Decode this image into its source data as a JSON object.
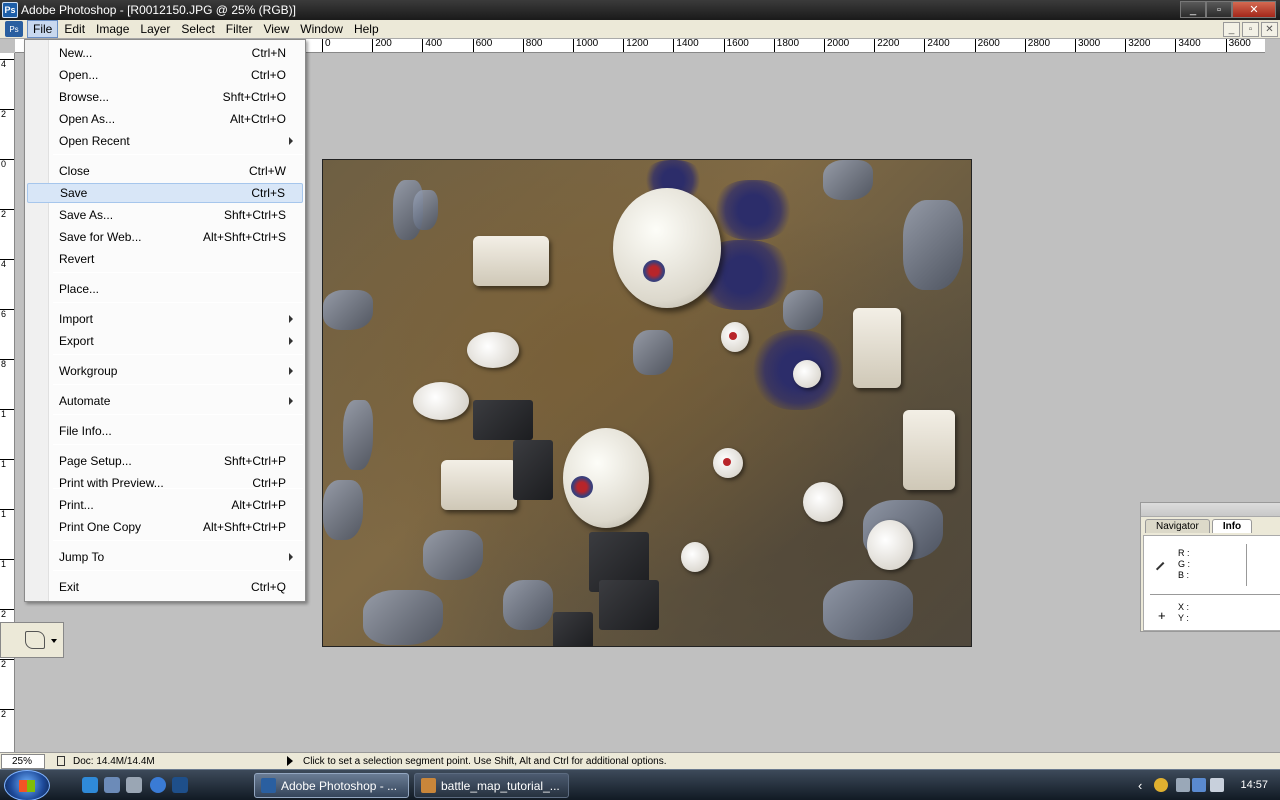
{
  "window": {
    "app_icon": "Ps",
    "title": "Adobe Photoshop - [R0012150.JPG @ 25% (RGB)]",
    "minimize": "_",
    "maximize": "▫",
    "close": "✕"
  },
  "menubar": {
    "items": [
      "File",
      "Edit",
      "Image",
      "Layer",
      "Select",
      "Filter",
      "View",
      "Window",
      "Help"
    ],
    "active": "File",
    "doc_controls": [
      "_",
      "▫",
      "✕"
    ]
  },
  "ruler_top": [
    "0",
    "200",
    "400",
    "600",
    "800",
    "1000",
    "1200",
    "1400",
    "1600",
    "1800",
    "2000",
    "2200",
    "2400",
    "2600",
    "2800",
    "3000",
    "3200",
    "3400",
    "3600"
  ],
  "ruler_left": [
    "4",
    "2",
    "0",
    "2",
    "4",
    "6",
    "8",
    "1",
    "1",
    "1",
    "1",
    "2",
    "2",
    "2",
    "2"
  ],
  "file_menu": {
    "items": [
      {
        "label": "New...",
        "shortcut": "Ctrl+N"
      },
      {
        "label": "Open...",
        "shortcut": "Ctrl+O"
      },
      {
        "label": "Browse...",
        "shortcut": "Shft+Ctrl+O"
      },
      {
        "label": "Open As...",
        "shortcut": "Alt+Ctrl+O"
      },
      {
        "label": "Open Recent",
        "shortcut": "",
        "submenu": true
      },
      {
        "label": "Close",
        "shortcut": "Ctrl+W"
      },
      {
        "label": "Save",
        "shortcut": "Ctrl+S",
        "highlighted": true
      },
      {
        "label": "Save As...",
        "shortcut": "Shft+Ctrl+S"
      },
      {
        "label": "Save for Web...",
        "shortcut": "Alt+Shft+Ctrl+S"
      },
      {
        "label": "Revert",
        "shortcut": ""
      },
      {
        "label": "Place...",
        "shortcut": ""
      },
      {
        "label": "Import",
        "shortcut": "",
        "submenu": true
      },
      {
        "label": "Export",
        "shortcut": "",
        "submenu": true
      },
      {
        "label": "Workgroup",
        "shortcut": "",
        "submenu": true
      },
      {
        "label": "Automate",
        "shortcut": "",
        "submenu": true
      },
      {
        "label": "File Info...",
        "shortcut": ""
      },
      {
        "label": "Page Setup...",
        "shortcut": "Shft+Ctrl+P"
      },
      {
        "label": "Print with Preview...",
        "shortcut": "Ctrl+P"
      },
      {
        "label": "Print...",
        "shortcut": "Alt+Ctrl+P"
      },
      {
        "label": "Print One Copy",
        "shortcut": "Alt+Shft+Ctrl+P"
      },
      {
        "label": "Jump To",
        "shortcut": "",
        "submenu": true
      },
      {
        "label": "Exit",
        "shortcut": "Ctrl+Q"
      }
    ]
  },
  "palette": {
    "tabs": [
      "Navigator",
      "Info"
    ],
    "active_tab": "Info",
    "rgb_labels": [
      "R :",
      "G :",
      "B :"
    ],
    "xy_labels": [
      "X :",
      "Y :"
    ]
  },
  "statusbar": {
    "zoom": "25%",
    "doc": "Doc: 14.4M/14.4M",
    "hint": "Click to set a selection segment point.  Use Shift, Alt and Ctrl for additional options."
  },
  "taskbar": {
    "tasks": [
      {
        "label": "Adobe Photoshop - ...",
        "active": true
      },
      {
        "label": "battle_map_tutorial_...",
        "active": false
      }
    ],
    "tray_chevron": "‹",
    "clock": "14:57"
  },
  "colors": {
    "highlight": "#d8e6f7",
    "titlebar": "#1a1a1a",
    "workspace": "#c0c0c0"
  }
}
